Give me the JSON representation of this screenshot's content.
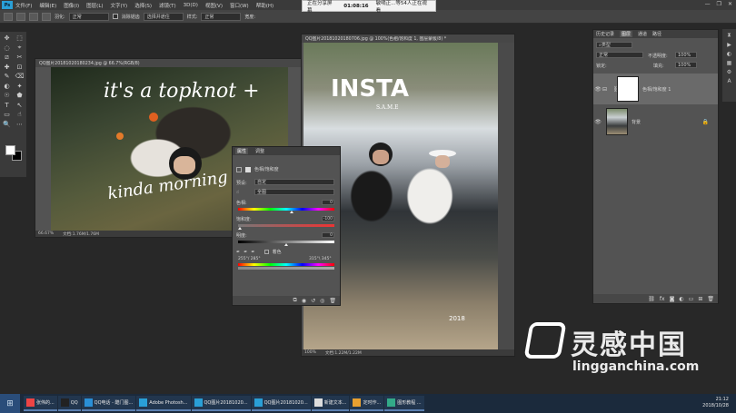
{
  "app": {
    "menu": [
      "文件(F)",
      "编辑(E)",
      "图像(I)",
      "图层(L)",
      "文字(Y)",
      "选择(S)",
      "滤镜(T)",
      "3D(D)",
      "视图(V)",
      "窗口(W)",
      "帮助(H)"
    ],
    "ps_logo": "Ps",
    "window_controls": [
      "—",
      "❐",
      "✕"
    ]
  },
  "recording": {
    "label": "正在分享屏幕",
    "time": "01:08:16",
    "viewers": "敏嘀正...等54人正在观看"
  },
  "options_bar": {
    "feather_label": "羽化:",
    "mode_label": "正常",
    "anti_alias": "消除锯齿",
    "refine": "选择并遮住",
    "style_label": "样式:",
    "style_value": "正常",
    "width_label": "宽度:",
    "height_label": "高度:"
  },
  "doc1": {
    "title": "QQ图片20181020180234.jpg @ 66.7%(RGB/8)",
    "status_zoom": "66.67%",
    "status_doc": "文档:1.76M/1.76M",
    "overlay_line1": "it's a topknot +",
    "overlay_line2": "kinda morning"
  },
  "doc2": {
    "title": "QQ图片20181020180706.jpg @ 100%(色相/饱和度 1, 图层蒙版/8) *",
    "status_zoom": "100%",
    "status_doc": "文档:1.22M/1.22M",
    "overlay_title": "INSTA",
    "overlay_sub": "S.A.M.E",
    "overlay_year": "2018"
  },
  "properties": {
    "tabs": [
      "属性",
      "调整"
    ],
    "header": "色相/饱和度",
    "preset_label": "预设:",
    "preset_value": "自定",
    "channel_value": "全图",
    "hue_label": "色相:",
    "hue_value": "0",
    "saturation_label": "饱和度:",
    "saturation_value": "-100",
    "lightness_label": "明度:",
    "lightness_value": "0",
    "colorize_label": "着色",
    "range_left": "255°/ 285°",
    "range_right": "315°\\ 345°",
    "hue_level": 0.56,
    "saturation_level": 0.02,
    "lightness_level": 0.5
  },
  "layers": {
    "tabs": [
      "历史记录",
      "图层",
      "通道",
      "路径"
    ],
    "kind_label": "类型",
    "blend_mode": "正常",
    "opacity_label": "不透明度:",
    "opacity_value": "100%",
    "lock_label": "锁定:",
    "fill_label": "填充:",
    "fill_value": "100%",
    "items": [
      {
        "name": "色相/饱和度 1",
        "visible": true
      },
      {
        "name": "背景",
        "visible": true,
        "locked": true
      }
    ],
    "footer_icons": [
      "link-icon",
      "fx-icon",
      "mask-icon",
      "adjustment-icon",
      "folder-icon",
      "new-layer-icon",
      "trash-icon"
    ]
  },
  "tools": [
    "✥",
    "⬚",
    "◌",
    "⌖",
    "⧄",
    "✂",
    "✚",
    "⊡",
    "✎",
    "⌫",
    "◐",
    "✦",
    "☉",
    "⬟",
    "T",
    "↖",
    "▭",
    "☝",
    "🔍",
    "⋯"
  ],
  "taskbar": {
    "items": [
      {
        "label": "张伟的...",
        "icon": "browser-icon",
        "color": "#e44"
      },
      {
        "label": "QQ",
        "icon": "qq-icon",
        "color": "#222"
      },
      {
        "label": "QQ电话 - 酷门图...",
        "icon": "qq-call-icon",
        "color": "#2a8fd6"
      },
      {
        "label": "Adobe Photosh...",
        "icon": "ps-icon",
        "color": "#2a9fd6"
      },
      {
        "label": "QQ图片20181020...",
        "icon": "ps-doc-icon",
        "color": "#2a9fd6"
      },
      {
        "label": "QQ图片20181020...",
        "icon": "ps-doc-icon",
        "color": "#2a9fd6"
      },
      {
        "label": "新建文本...",
        "icon": "notepad-icon",
        "color": "#ddd"
      },
      {
        "label": "定时作...",
        "icon": "folder-icon",
        "color": "#e8a030"
      },
      {
        "label": "图形教程 ...",
        "icon": "app-icon",
        "color": "#3a8"
      }
    ],
    "time": "21:12",
    "date": "2018/10/28"
  },
  "watermark": {
    "cn": "灵感中国",
    "en": "lingganchina.com"
  }
}
